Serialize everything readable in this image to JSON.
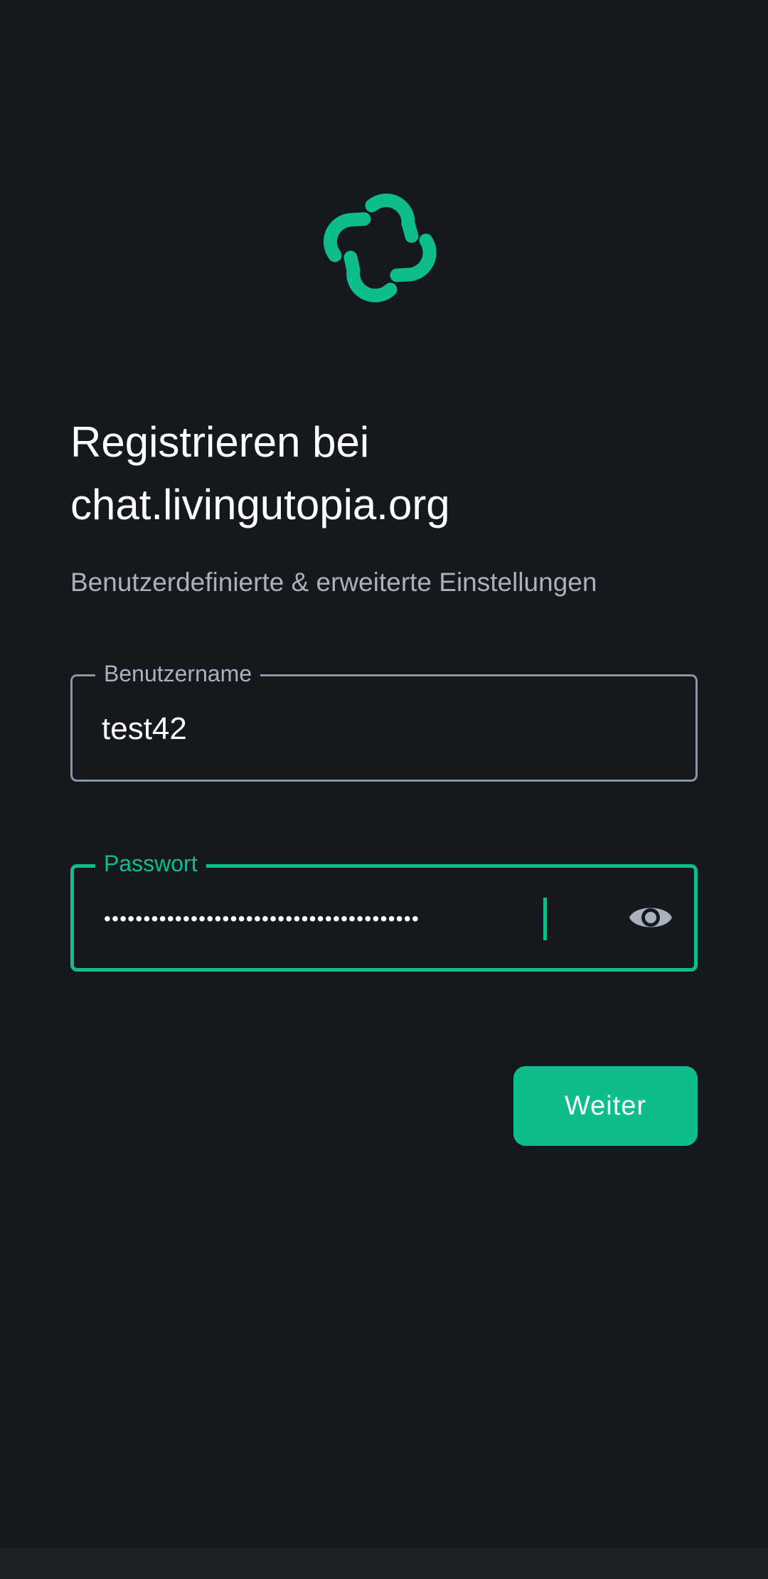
{
  "header": {
    "title_line1": "Registrieren bei",
    "title_line2": "chat.livingutopia.org",
    "subtitle": "Benutzerdefinierte & erweiterte Einstellungen"
  },
  "username_field": {
    "label": "Benutzername",
    "value": "test42"
  },
  "password_field": {
    "label": "Passwort",
    "masked_value": "••••••••••••••••••••••••••••••••••••••••",
    "visibility_icon": "eye-icon"
  },
  "actions": {
    "continue_label": "Weiter"
  },
  "colors": {
    "background": "#15191e",
    "accent": "#0dbd8b",
    "secondary_text": "#a9b2bc",
    "field_border": "#8d97a5"
  },
  "icons": {
    "logo": "element-logo-icon"
  }
}
